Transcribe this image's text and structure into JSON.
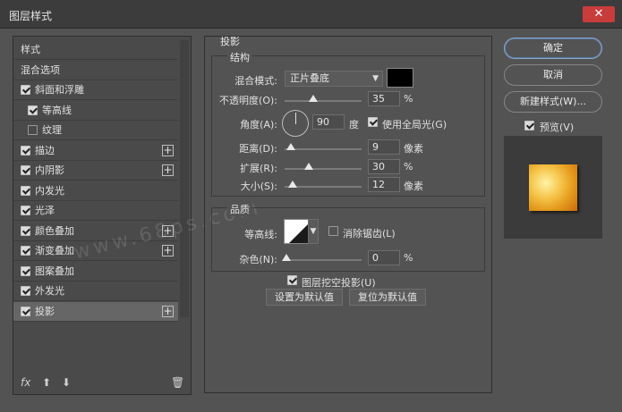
{
  "window": {
    "title": "图层样式",
    "close": "✕"
  },
  "left": {
    "items": [
      {
        "label": "样式",
        "checkbox": null,
        "plus": false,
        "selected": false,
        "indent": false
      },
      {
        "label": "混合选项",
        "checkbox": null,
        "plus": false,
        "selected": false,
        "indent": false
      },
      {
        "label": "斜面和浮雕",
        "checkbox": "on",
        "plus": false,
        "selected": false,
        "indent": false
      },
      {
        "label": "等高线",
        "checkbox": "on",
        "plus": false,
        "selected": false,
        "indent": true
      },
      {
        "label": "纹理",
        "checkbox": "off",
        "plus": false,
        "selected": false,
        "indent": true
      },
      {
        "label": "描边",
        "checkbox": "on",
        "plus": true,
        "selected": false,
        "indent": false
      },
      {
        "label": "内阴影",
        "checkbox": "on",
        "plus": true,
        "selected": false,
        "indent": false
      },
      {
        "label": "内发光",
        "checkbox": "on",
        "plus": false,
        "selected": false,
        "indent": false
      },
      {
        "label": "光泽",
        "checkbox": "on",
        "plus": false,
        "selected": false,
        "indent": false
      },
      {
        "label": "颜色叠加",
        "checkbox": "on",
        "plus": true,
        "selected": false,
        "indent": false
      },
      {
        "label": "渐变叠加",
        "checkbox": "on",
        "plus": true,
        "selected": false,
        "indent": false
      },
      {
        "label": "图案叠加",
        "checkbox": "on",
        "plus": false,
        "selected": false,
        "indent": false
      },
      {
        "label": "外发光",
        "checkbox": "on",
        "plus": false,
        "selected": false,
        "indent": false
      },
      {
        "label": "投影",
        "checkbox": "on",
        "plus": true,
        "selected": true,
        "indent": false
      }
    ],
    "footer": {
      "fx": "fx",
      "up": "⬆",
      "down": "⬇",
      "trash": "🗑"
    }
  },
  "center": {
    "section_title": "投影",
    "structure": {
      "title": "结构",
      "blend_label": "混合模式:",
      "blend_value": "正片叠底",
      "opacity_label": "不透明度(O):",
      "opacity_value": "35",
      "opacity_unit": "%",
      "opacity_level": 0.35,
      "angle_label": "角度(A):",
      "angle_value": "90",
      "angle_unit": "度",
      "global_light_label": "使用全局光(G)",
      "distance_label": "距离(D):",
      "distance_value": "9",
      "distance_unit": "像素",
      "spread_label": "扩展(R):",
      "spread_value": "30",
      "spread_unit": "%",
      "size_label": "大小(S):",
      "size_value": "12",
      "size_unit": "像素"
    },
    "quality": {
      "title": "品质",
      "contour_label": "等高线:",
      "antialias_label": "消除锯齿(L)",
      "noise_label": "杂色(N):",
      "noise_value": "0",
      "noise_unit": "%"
    },
    "knockout_label": "图层挖空投影(U)",
    "set_default": "设置为默认值",
    "reset_default": "复位为默认值"
  },
  "right": {
    "ok": "确定",
    "cancel": "取消",
    "new_style": "新建样式(W)...",
    "preview_label": "预览(V)"
  },
  "watermark": "www.68ps.com",
  "colors": {
    "shadow_color": "#000000",
    "accent": "#8aa4c6"
  }
}
